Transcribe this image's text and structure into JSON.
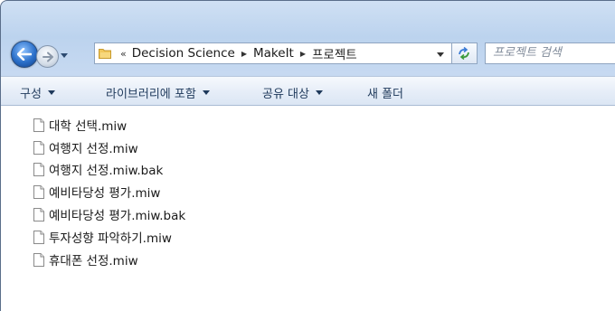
{
  "nav": {
    "back_icon": "back-arrow-icon",
    "forward_icon": "forward-arrow-icon"
  },
  "address": {
    "chevron": "«",
    "crumbs": [
      "Decision Science",
      "MakeIt",
      "프로젝트"
    ]
  },
  "search": {
    "placeholder": "프로젝트 검색"
  },
  "toolbar": {
    "organize": "구성",
    "include_in_library": "라이브러리에 포함",
    "share_with": "공유 대상",
    "new_folder": "새 폴더"
  },
  "files": [
    "대학 선택.miw",
    "여행지 선정.miw",
    "여행지 선정.miw.bak",
    "예비타당성 평가.miw",
    "예비타당성 평가.miw.bak",
    "투자성향 파악하기.miw",
    "휴대폰 선정.miw"
  ],
  "colors": {
    "frame": "#c6d9f1",
    "accent": "#2a6fc9",
    "toolbar_text": "#1e395b"
  }
}
